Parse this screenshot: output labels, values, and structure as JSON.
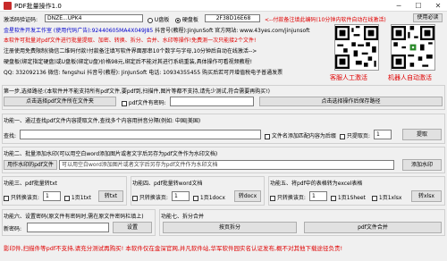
{
  "window": {
    "title": "PDF批量操作1.0",
    "minimize": "─",
    "maximize": "☐",
    "close": "✕"
  },
  "reg": {
    "code_label": "激活码验证码:",
    "code_value": "DNZE...UPK4",
    "usb_label": "U盘板",
    "disk_label": "硬盘板",
    "disk_id": "2F38D16E68",
    "note": "<--付款备注填此编码(10分钟内软件自动在线激活)",
    "help_btn": "使用必读"
  },
  "info": {
    "line1_blue": "金星软件开发工作室 (使用代码广告):92440605MA4X049J85",
    "line1_black": "抖音号(教程):JinJunSoft  官方网站: www.43yes.com/jinjunsoft",
    "line2": "本软件可批量对pdf文件进行批量提取、加密、转换、拆分、合并、水印等操作!免费测一次只能接2个文件!",
    "line3": "注册使用免费限制(微信二维码付款!付款备注填写软件界面那串10个数字与字母,10分钟后自动在线激活-->",
    "line4": "硬盘板(绑定指定硬盘)或U盘板(绑定U盘)价格98元,绑定后不能对其进行系统重装,具体操作可看视频教程!",
    "line5": "QQ: 332092136  微信: fengshui  抖音号(教程): JinJunSoft  电话: 10934355455  购买后若可开增值税电子普通发票"
  },
  "qr": {
    "left_caption": "客服人工激活",
    "right_caption": "机器人自动激活"
  },
  "step1": {
    "header": "第一步,选择路径:(本软件并不能支持所有pdf文件,要pdf到,扫描件,图片等都不支持,请先少测试,符合需要再购买!)",
    "src_btn": "点击选择pdf文件所在文件夹",
    "pw_label": "pdf文件有密码:",
    "dst_btn": "点击选择操作后保存路径"
  },
  "f1": {
    "header": "功能一、通过查找pdf文件内容提取文件,查找多个内容用拼音分隔(例如: 中国|美国)",
    "find_label": "查找:",
    "rename_label": "文件名添加匹配内容为后缀",
    "only_label": "只提取页:",
    "only_value": "1",
    "extract_btn": "提取"
  },
  "f2": {
    "header": "功能二、批量添加水印(可以用空白word添加图片或者文字后另存为pdf文件作为水印文档)",
    "wm_btn": "用作水印的pdf文件",
    "wm_input": "可以用空白word添加图片或者文字后另存为pdf文件作为水印文档",
    "add_btn": "添加水印"
  },
  "f3": {
    "header": "功能三、pdf批量转txt",
    "range_label": "只转换该页:",
    "range_value": "1",
    "sep": "1页1txt",
    "btn": "转txt"
  },
  "f4": {
    "header": "功能四、pdf批量转word文档",
    "range_label": "只转换该页:",
    "range_value": "1",
    "sep": "1页1docx",
    "btn": "转docx"
  },
  "f5": {
    "header": "功能五、将pdf中的表格转为excel表格",
    "range_label": "只转换该页:",
    "range_value": "1",
    "sep1": "1页1Sheet",
    "sep2": "1页1xlsx",
    "btn": "转xlsx"
  },
  "f6": {
    "header": "功能六、设置密码(原文件有密码时,需在原文件密码栏填上)",
    "pw_label": "新密码:",
    "set_btn": "设置"
  },
  "f7": {
    "header": "功能七、拆分合并",
    "split_btn": "按页拆分",
    "merge_btn": "pdf文件合并"
  },
  "footer": "影印件,扫描件等pdf不支持,请充分测试再购买! 本软件仅在金深官网,并凡软件站,华军软件园实名认证发布,概不对其他下载途径负责!"
}
